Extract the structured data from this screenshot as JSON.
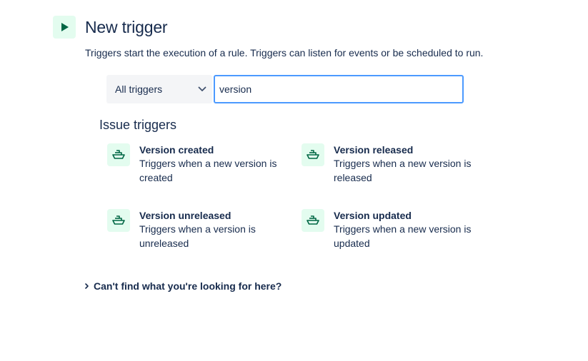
{
  "header": {
    "title": "New trigger",
    "icon": "play-icon",
    "accent_color": "#006644",
    "icon_bg": "#e3fcef"
  },
  "subtitle": "Triggers start the execution of a rule. Triggers can listen for events or be scheduled to run.",
  "filter": {
    "selected": "All triggers"
  },
  "search": {
    "value": "version"
  },
  "section": {
    "title": "Issue triggers"
  },
  "triggers": [
    {
      "title": "Version created",
      "description": "Triggers when a new version is created",
      "icon": "ship-icon"
    },
    {
      "title": "Version released",
      "description": "Triggers when a new version is released",
      "icon": "ship-icon"
    },
    {
      "title": "Version unreleased",
      "description": "Triggers when a version is unreleased",
      "icon": "ship-icon"
    },
    {
      "title": "Version updated",
      "description": "Triggers when a new version is updated",
      "icon": "ship-icon"
    }
  ],
  "help": {
    "label": "Can't find what you're looking for here?"
  }
}
